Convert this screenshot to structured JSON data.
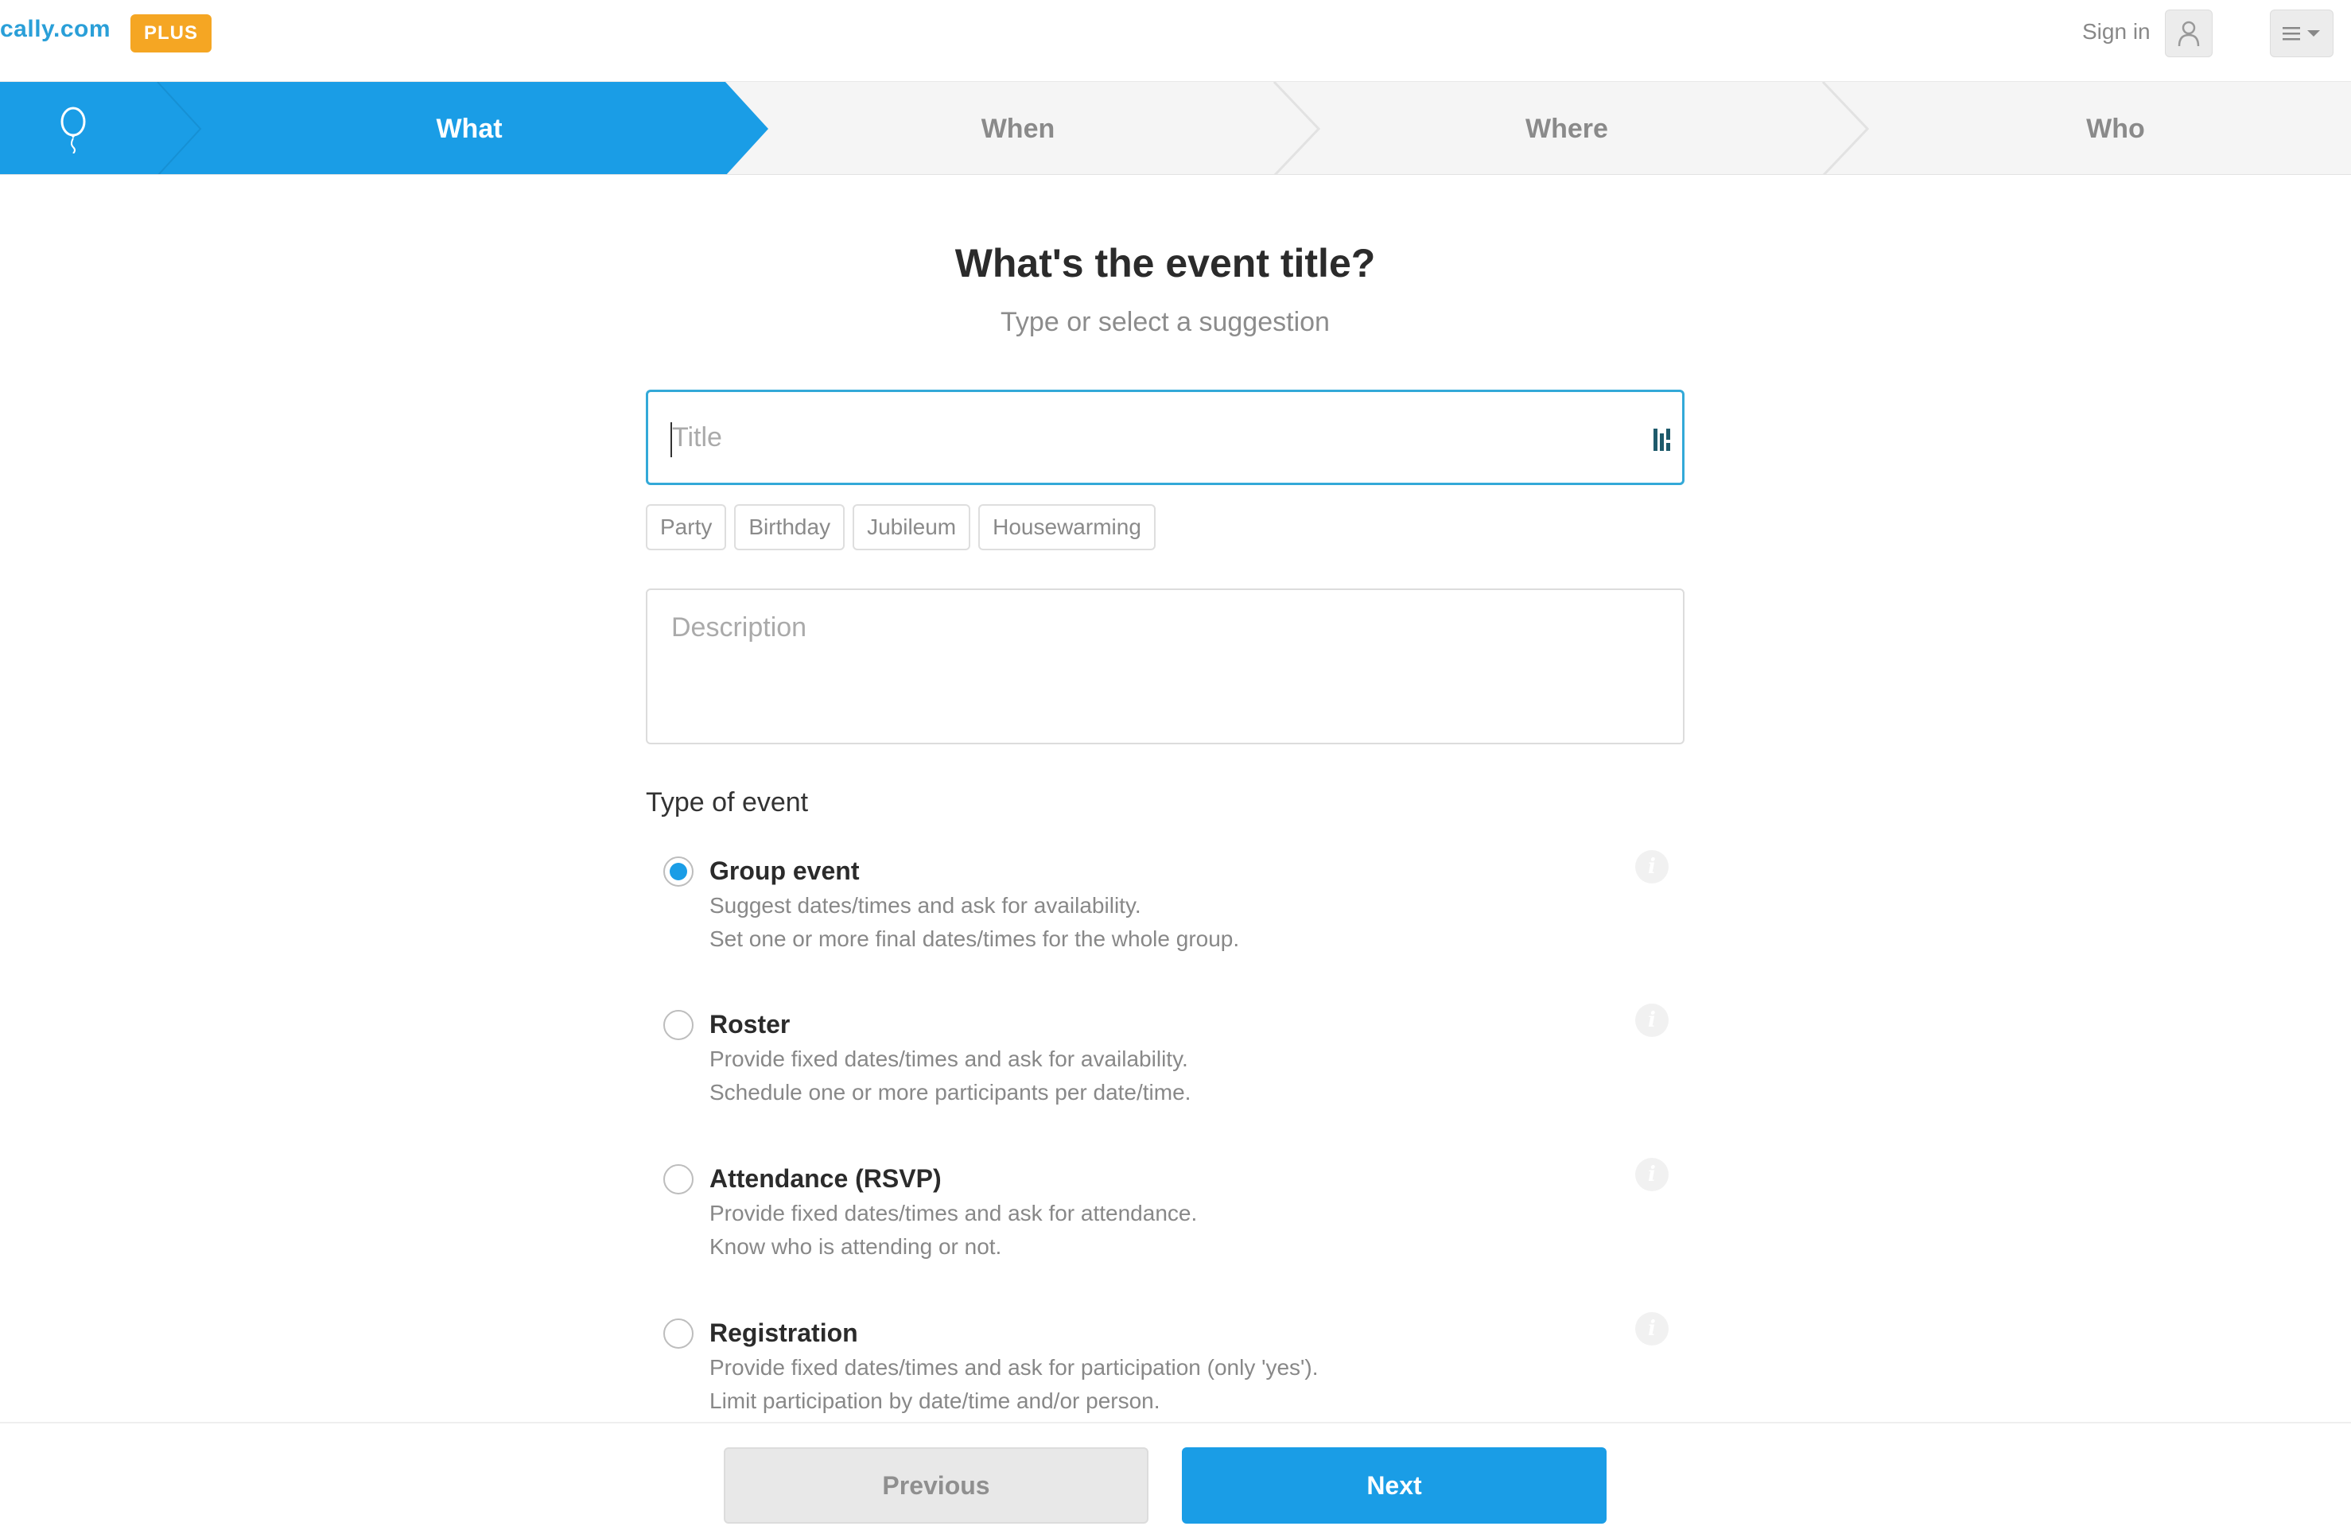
{
  "header": {
    "brand": "cally.com",
    "plus_badge": "PLUS",
    "signin": "Sign in",
    "icons": {
      "avatar": "user-icon",
      "menu": "hamburger-icon",
      "menu_caret": "caret-down-icon",
      "steps_home": "balloon-icon"
    }
  },
  "steps": {
    "items": [
      {
        "label": "What",
        "active": true
      },
      {
        "label": "When",
        "active": false
      },
      {
        "label": "Where",
        "active": false
      },
      {
        "label": "Who",
        "active": false
      }
    ],
    "colors": {
      "active_bg": "#1a9de6",
      "inactive_bg": "#f5f5f5"
    }
  },
  "main": {
    "title": "What's the event title?",
    "subtitle": "Type or select a suggestion",
    "title_input": {
      "placeholder": "Title",
      "value": ""
    },
    "suggestions": [
      "Party",
      "Birthday",
      "Jubileum",
      "Housewarming"
    ],
    "description_input": {
      "placeholder": "Description",
      "value": ""
    },
    "type_heading": "Type of event",
    "options": [
      {
        "title": "Group event",
        "lines": [
          "Suggest dates/times and ask for availability.",
          "Set one or more final dates/times for the whole group."
        ],
        "selected": true
      },
      {
        "title": "Roster",
        "lines": [
          "Provide fixed dates/times and ask for availability.",
          "Schedule one or more participants per date/time."
        ],
        "selected": false
      },
      {
        "title": "Attendance (RSVP)",
        "lines": [
          "Provide fixed dates/times and ask for attendance.",
          "Know who is attending or not."
        ],
        "selected": false
      },
      {
        "title": "Registration",
        "lines": [
          "Provide fixed dates/times and ask for participation (only 'yes').",
          "Limit participation by date/time and/or person."
        ],
        "selected": false
      }
    ],
    "info_icon": "i"
  },
  "footer": {
    "previous_label": "Previous",
    "next_label": "Next"
  },
  "colors": {
    "accent": "#1a9de6",
    "badge": "#f5a623"
  }
}
